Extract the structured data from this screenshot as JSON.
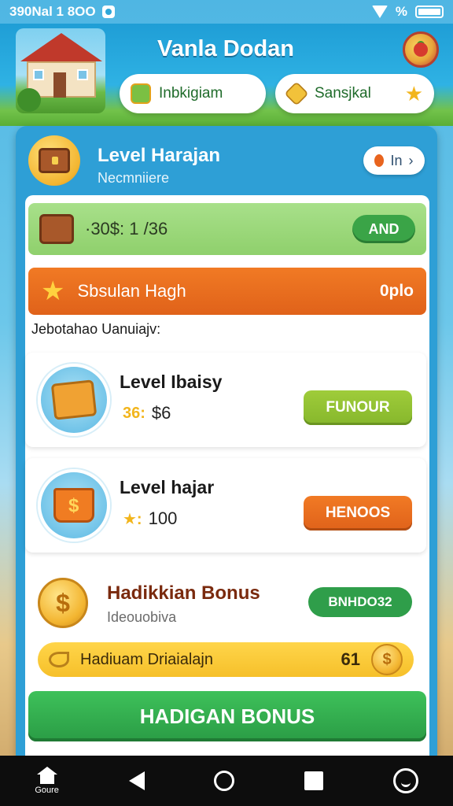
{
  "status_bar": {
    "time": "390Nal 1 8OO"
  },
  "header": {
    "title": "Vanla Dodan",
    "pill_left": {
      "label": "Inbkigiam",
      "icon": "toy-icon"
    },
    "pill_right": {
      "label": "Sansjkal",
      "icon": "gem-icon"
    }
  },
  "panel": {
    "title": "Level Harajan",
    "subtitle": "Necmniiere",
    "in_button": "In",
    "progress": {
      "value": "·30$: 1 /36",
      "button": "AND"
    },
    "highlight": {
      "label": "Sbsulan Hagh",
      "value": "0plo"
    },
    "section_label": "Jebotahao Uanuiajv:",
    "items": [
      {
        "name": "Level Ibaisy",
        "coin": "36:",
        "price": "$6",
        "button": "FUNOUR",
        "color": "#8fbd30"
      },
      {
        "name": "Level hajar",
        "coin": "★:",
        "price": "100",
        "button": "HENOOS",
        "color": "#e8671d"
      }
    ],
    "bonus": {
      "title": "Hadikkian Bonus",
      "subtitle": "Ideouobiva",
      "button": "BNHDO32",
      "bar_label": "Hadiuam Driaialajn",
      "bar_count": "61"
    },
    "cta": "HADIGAN BONUS"
  },
  "navbar": {
    "home_label": "Goure"
  },
  "colors": {
    "primary_blue": "#2e9fd6",
    "green": "#2f9e4a",
    "orange": "#e0621a",
    "yellow": "#f6c02a"
  }
}
